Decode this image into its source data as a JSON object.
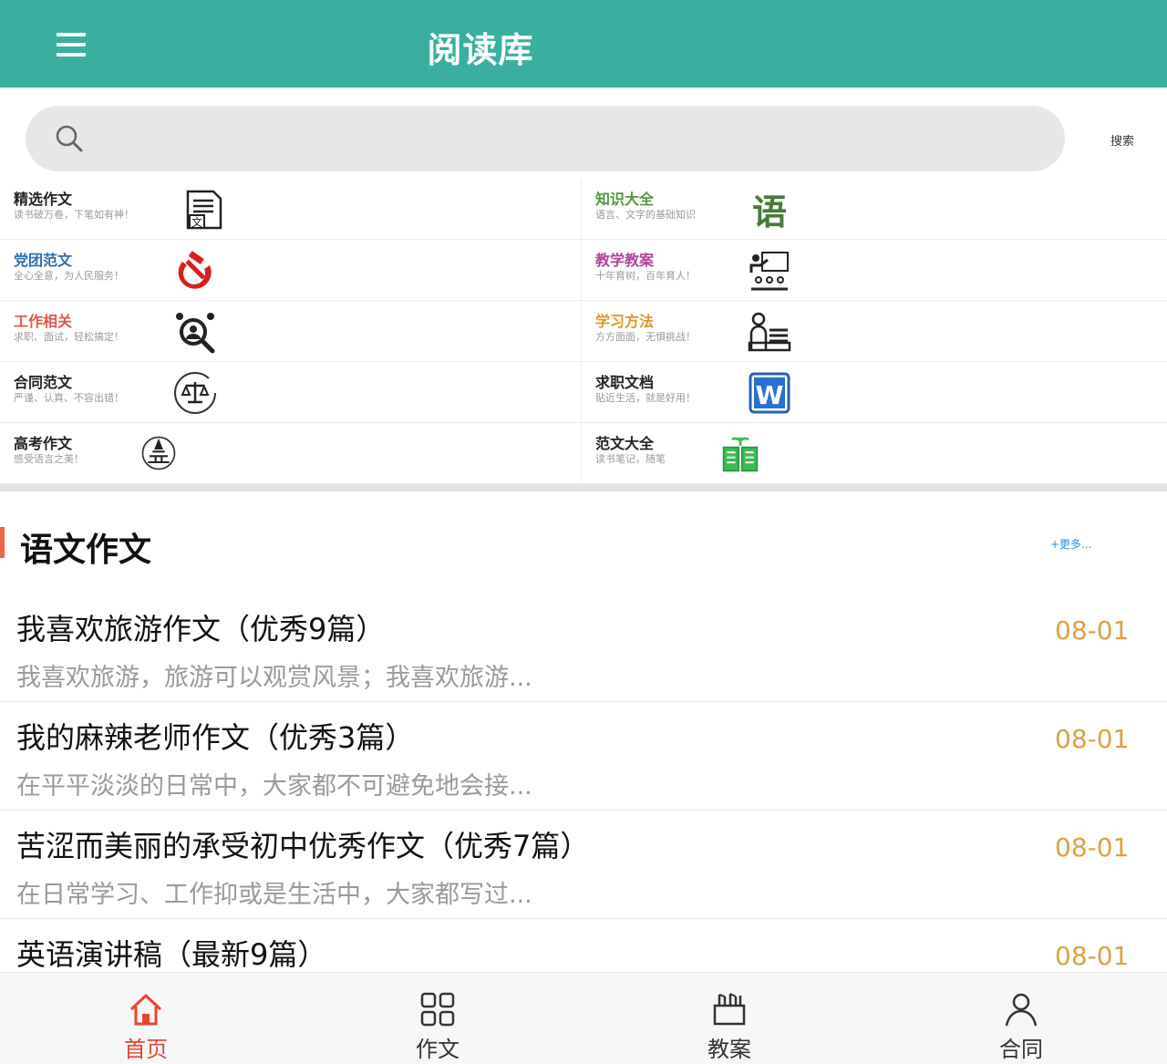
{
  "header": {
    "title": "阅读库"
  },
  "search": {
    "placeholder": "",
    "button_label": "搜索"
  },
  "categories": [
    {
      "title": "精选作文",
      "subtitle": "读书破万卷，下笔如有神！",
      "color": "#222222",
      "icon": "document-icon"
    },
    {
      "title": "知识大全",
      "subtitle": "语言、文字的基础知识",
      "color": "#4a9a3a",
      "icon": "yu-character-icon"
    },
    {
      "title": "党团范文",
      "subtitle": "全心全意，为人民服务！",
      "color": "#2a6fb0",
      "icon": "hammer-sickle-icon"
    },
    {
      "title": "教学教案",
      "subtitle": "十年育树，百年育人！",
      "color": "#b0449a",
      "icon": "teacher-icon"
    },
    {
      "title": "工作相关",
      "subtitle": "求职、面试，轻松搞定！",
      "color": "#e0574a",
      "icon": "job-search-icon"
    },
    {
      "title": "学习方法",
      "subtitle": "方方面面，无惧挑战！",
      "color": "#e0952a",
      "icon": "student-desk-icon"
    },
    {
      "title": "合同范文",
      "subtitle": "严谨、认真、不容出错！",
      "color": "#222222",
      "icon": "scales-icon"
    },
    {
      "title": "求职文档",
      "subtitle": "贴近生活，就是好用！",
      "color": "#222222",
      "icon": "word-doc-icon"
    },
    {
      "title": "高考作文",
      "subtitle": "感受语言之美！",
      "color": "#222222",
      "icon": "college-exam-icon"
    },
    {
      "title": "范文大全",
      "subtitle": "读书笔记，随笔",
      "color": "#222222",
      "icon": "sprout-book-icon"
    }
  ],
  "section": {
    "title": "语文作文",
    "more_label": "+更多..."
  },
  "articles": [
    {
      "title": "我喜欢旅游作文（优秀9篇）",
      "summary": "我喜欢旅游，旅游可以观赏风景；我喜欢旅游...",
      "date": "08-01"
    },
    {
      "title": "我的麻辣老师作文（优秀3篇）",
      "summary": "在平平淡淡的日常中，大家都不可避免地会接...",
      "date": "08-01"
    },
    {
      "title": "苦涩而美丽的承受初中优秀作文（优秀7篇）",
      "summary": "在日常学习、工作抑或是生活中，大家都写过...",
      "date": "08-01"
    },
    {
      "title": "英语演讲稿（最新9篇）",
      "summary": "",
      "date": "08-01"
    }
  ],
  "tabs": [
    {
      "label": "首页",
      "icon": "home-icon",
      "active": true
    },
    {
      "label": "作文",
      "icon": "grid-icon",
      "active": false
    },
    {
      "label": "教案",
      "icon": "pen-holder-icon",
      "active": false
    },
    {
      "label": "合同",
      "icon": "user-icon",
      "active": false
    }
  ],
  "colors": {
    "header_bg": "#3aaf9f",
    "accent_red": "#e8452f",
    "date": "#e0a040",
    "more_link": "#2a8de0"
  }
}
